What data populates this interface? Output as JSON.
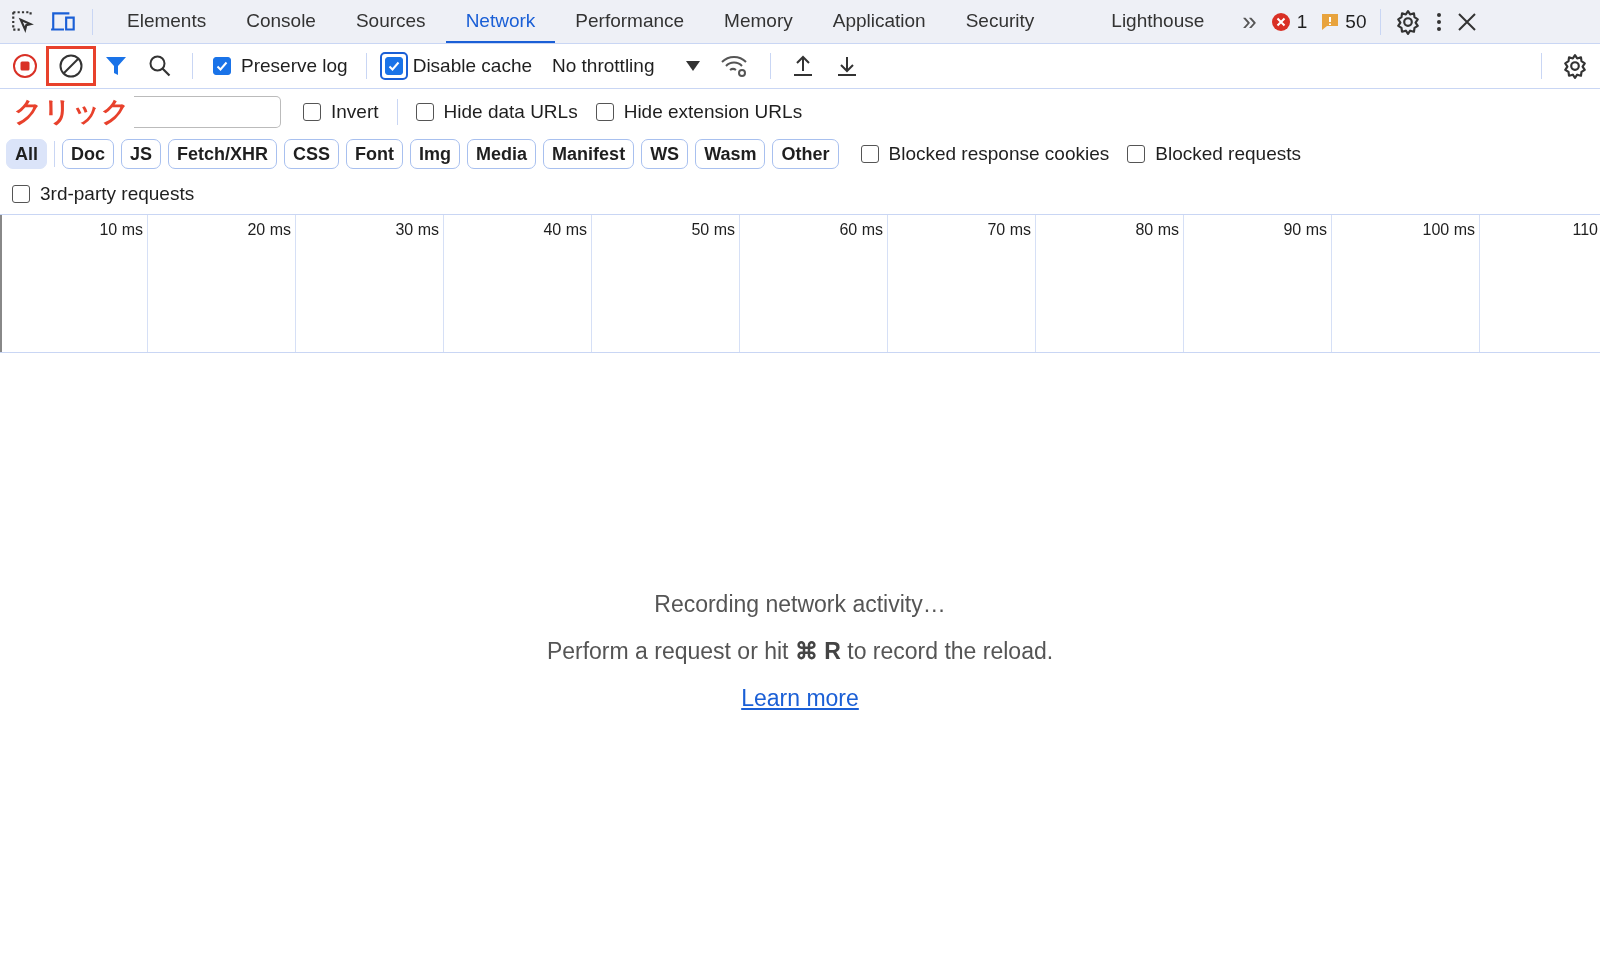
{
  "tabs": [
    {
      "label": "Elements",
      "selected": false
    },
    {
      "label": "Console",
      "selected": false
    },
    {
      "label": "Sources",
      "selected": false
    },
    {
      "label": "Network",
      "selected": true
    },
    {
      "label": "Performance",
      "selected": false
    },
    {
      "label": "Memory",
      "selected": false
    },
    {
      "label": "Application",
      "selected": false
    },
    {
      "label": "Security",
      "selected": false
    },
    {
      "label": "Lighthouse",
      "selected": false
    }
  ],
  "more_tabs": "»",
  "errors": "1",
  "warnings": "50",
  "toolbar": {
    "recording": true,
    "clear_highlighted": true,
    "options": [
      {
        "label": "Preserve log",
        "checked": true,
        "focused": false
      },
      {
        "label": "Disable cache",
        "checked": true,
        "focused": true
      }
    ],
    "throttling": "No throttling"
  },
  "annotation": {
    "label": "クリック"
  },
  "filter_options": [
    {
      "label": "Invert",
      "checked": false
    },
    {
      "label": "Hide data URLs",
      "checked": false
    },
    {
      "label": "Hide extension URLs",
      "checked": false
    }
  ],
  "type_filters": [
    {
      "label": "All",
      "selected": true
    },
    {
      "label": "Doc",
      "selected": false
    },
    {
      "label": "JS",
      "selected": false
    },
    {
      "label": "Fetch/XHR",
      "selected": false
    },
    {
      "label": "CSS",
      "selected": false
    },
    {
      "label": "Font",
      "selected": false
    },
    {
      "label": "Img",
      "selected": false
    },
    {
      "label": "Media",
      "selected": false
    },
    {
      "label": "Manifest",
      "selected": false
    },
    {
      "label": "WS",
      "selected": false
    },
    {
      "label": "Wasm",
      "selected": false
    },
    {
      "label": "Other",
      "selected": false
    }
  ],
  "blocked_options": [
    {
      "label": "Blocked response cookies",
      "checked": false
    },
    {
      "label": "Blocked requests",
      "checked": false
    }
  ],
  "third_party": {
    "label": "3rd-party requests",
    "checked": false
  },
  "timeline_ticks": [
    "10 ms",
    "20 ms",
    "30 ms",
    "40 ms",
    "50 ms",
    "60 ms",
    "70 ms",
    "80 ms",
    "90 ms",
    "100 ms",
    "110"
  ],
  "empty": {
    "title": "Recording network activity…",
    "hint_before": "Perform a request or hit ",
    "shortcut": "⌘ R",
    "hint_after": " to record the reload.",
    "link": "Learn more"
  }
}
